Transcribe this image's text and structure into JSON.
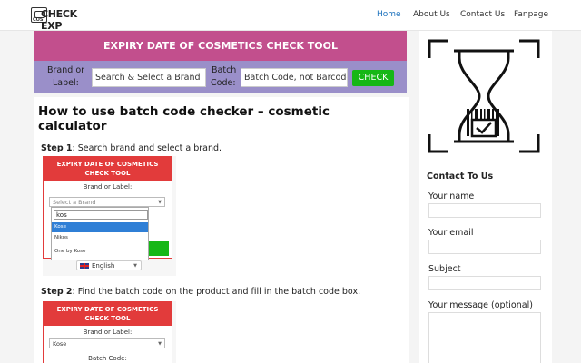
{
  "header": {
    "logo_text": "CHECK EXP",
    "logo_small": "COS",
    "nav": [
      "Home",
      "About Us",
      "Contact Us",
      "Fanpage"
    ],
    "active_color": "#1e73be"
  },
  "tool": {
    "title": "EXPIRY DATE OF COSMETICS CHECK TOOL",
    "brand_label_line1": "Brand or",
    "brand_label_line2": "Label:",
    "brand_placeholder": "Search & Select a Brand",
    "batch_label_line1": "Batch",
    "batch_label_line2": "Code:",
    "batch_placeholder": "Batch Code, not Barcode",
    "button": "CHECK",
    "colors": {
      "title_bg": "#c24f8d",
      "row_bg": "#9a8fc9",
      "button": "#16b716"
    }
  },
  "article": {
    "heading": "How to use batch code checker – cosmetic calculator",
    "step1_label": "Step 1",
    "step1_text": ": Search brand and select a brand.",
    "step2_label": "Step 2",
    "step2_text": ": Find the batch code on the product and fill in the batch code box."
  },
  "shot1": {
    "title": "EXPIRY DATE OF COSMETICS CHECK TOOL",
    "label": "Brand or Label:",
    "select_placeholder": "Select a Brand",
    "search_value": "kos",
    "options": [
      "Kose",
      "Nikos",
      "One by Kose"
    ],
    "language": "English"
  },
  "shot2": {
    "title": "EXPIRY DATE OF COSMETICS CHECK TOOL",
    "label": "Brand or Label:",
    "selected": "Kose",
    "batch_label": "Batch Code:"
  },
  "sidebar": {
    "icon": "hourglass-barcode-icon",
    "contact_title": "Contact To Us",
    "fields": [
      "Your name",
      "Your email",
      "Subject",
      "Your message (optional)"
    ]
  }
}
